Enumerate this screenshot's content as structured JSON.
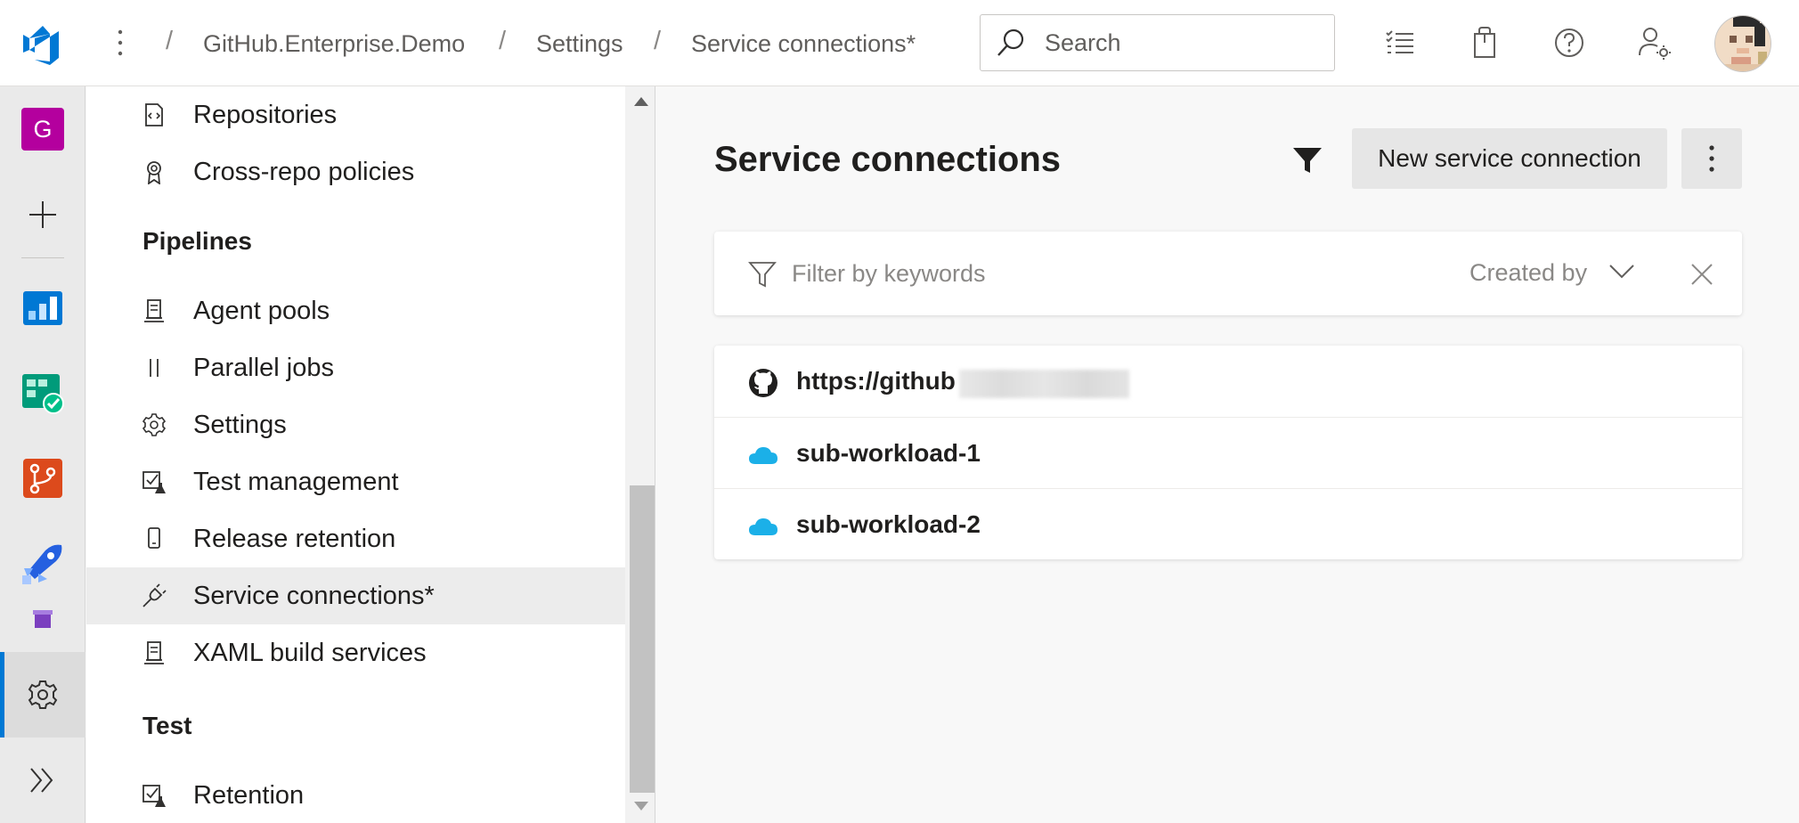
{
  "header": {
    "breadcrumbs": [
      "GitHub.Enterprise.Demo",
      "Settings",
      "Service connections*"
    ],
    "search_placeholder": "Search"
  },
  "rail": {
    "project_initial": "G"
  },
  "nav": {
    "items_top": [
      {
        "label": "Repositories",
        "icon": "repo-icon"
      },
      {
        "label": "Cross-repo policies",
        "icon": "badge-icon"
      }
    ],
    "section_pipelines": "Pipelines",
    "pipelines_items": [
      {
        "label": "Agent pools",
        "icon": "agent-icon"
      },
      {
        "label": "Parallel jobs",
        "icon": "parallel-icon"
      },
      {
        "label": "Settings",
        "icon": "gear-icon"
      },
      {
        "label": "Test management",
        "icon": "test-icon"
      },
      {
        "label": "Release retention",
        "icon": "phone-icon"
      },
      {
        "label": "Service connections*",
        "icon": "plug-icon"
      },
      {
        "label": "XAML build services",
        "icon": "agent-icon"
      }
    ],
    "section_test": "Test",
    "test_items": [
      {
        "label": "Retention",
        "icon": "test-icon"
      }
    ]
  },
  "main": {
    "title": "Service connections",
    "new_button": "New service connection",
    "filter_placeholder": "Filter by keywords",
    "created_by": "Created by",
    "connections": [
      {
        "label": "https://github",
        "icon": "github-icon"
      },
      {
        "label": "sub-workload-1",
        "icon": "azure-cloud-icon"
      },
      {
        "label": "sub-workload-2",
        "icon": "azure-cloud-icon"
      }
    ]
  },
  "colors": {
    "accent": "#0078d4",
    "project_badge": "#b4009e",
    "azure_cloud": "#1bb0e8"
  }
}
